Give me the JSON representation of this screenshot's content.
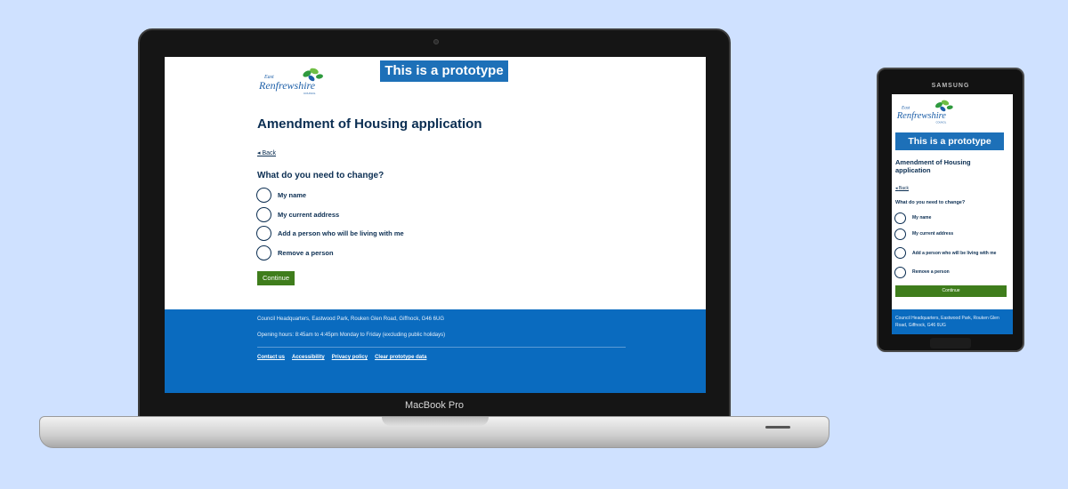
{
  "laptop": {
    "model_label": "MacBook Pro",
    "page": {
      "logo_text_top": "East",
      "logo_text_main": "Renfrewshire",
      "logo_text_sub": "COUNCIL",
      "prototype_banner": "This is a prototype",
      "title": "Amendment of Housing application",
      "back_link": "Back",
      "question": "What do you need to change?",
      "options": [
        {
          "label": "My name"
        },
        {
          "label": "My current address"
        },
        {
          "label": "Add a person who will be living with me"
        },
        {
          "label": "Remove a person"
        }
      ],
      "continue_label": "Continue",
      "footer": {
        "address": "Council Headquarters, Eastwood Park, Rouken Glen Road, Giffnock, G46 6UG",
        "hours": "Opening hours: 8:45am to 4:45pm Monday to Friday (excluding public holidays)",
        "links": [
          "Contact us",
          "Accessibility",
          "Privacy policy",
          "Clear prototype data"
        ]
      }
    }
  },
  "phone": {
    "brand_label": "SAMSUNG",
    "page": {
      "logo_text_top": "East",
      "logo_text_main": "Renfrewshire",
      "logo_text_sub": "COUNCIL",
      "prototype_banner": "This is a prototype",
      "title": "Amendment of Housing application",
      "back_link": "Back",
      "question": "What do you need to change?",
      "options": [
        {
          "label": "My name"
        },
        {
          "label": "My current address"
        },
        {
          "label": "Add a person who will be living with me"
        },
        {
          "label": "Remove a person"
        }
      ],
      "continue_label": "Continue",
      "footer": {
        "address": "Council Headquarters, Eastwood Park, Rouken Glen Road, Giffnock, G46 6UG"
      }
    }
  },
  "colors": {
    "background": "#cfe1ff",
    "banner_blue": "#1d70b8",
    "footer_blue": "#0a6bbf",
    "heading_navy": "#0b2e52",
    "button_green": "#3f7d1c"
  }
}
